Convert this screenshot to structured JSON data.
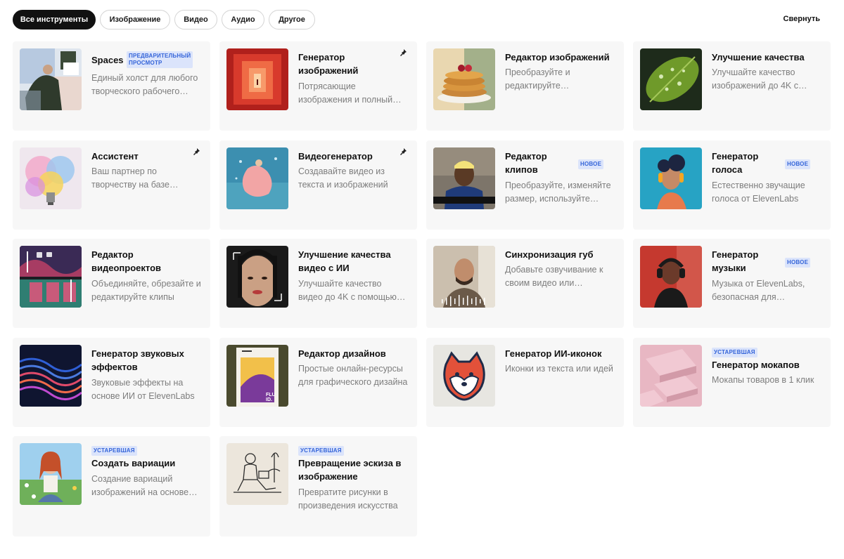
{
  "filters": {
    "all": "Все инструменты",
    "image": "Изображение",
    "video": "Видео",
    "audio": "Аудио",
    "other": "Другое",
    "collapse": "Свернуть"
  },
  "badges": {
    "preview_line1": "Предварительный",
    "preview_line2": "просмотр",
    "new": "Новое",
    "legacy": "Устаревшая"
  },
  "cards": {
    "spaces": {
      "title": "Spaces",
      "desc1": "Единый холст для любого",
      "desc2": "творческого рабочего…"
    },
    "image_gen": {
      "title1": "Генератор",
      "title2": "изображений",
      "desc1": "Потрясающие",
      "desc2": "изображения и полный…"
    },
    "image_editor": {
      "title": "Редактор изображений",
      "desc1": "Преобразуйте и",
      "desc2": "редактируйте…"
    },
    "upscale": {
      "title": "Улучшение качества",
      "desc1": "Улучшайте качество",
      "desc2": "изображений до 4K с…"
    },
    "assistant": {
      "title": "Ассистент",
      "desc1": "Ваш партнер по",
      "desc2": "творчеству на базе…"
    },
    "video_gen": {
      "title": "Видеогенератор",
      "desc1": "Создавайте видео из",
      "desc2": "текста и изображений"
    },
    "clip_editor": {
      "title1": "Редактор",
      "title2": "клипов",
      "desc1": "Преобразуйте, изменяйте",
      "desc2": "размер, используйте…"
    },
    "voice_gen": {
      "title1": "Генератор",
      "title2": "голоса",
      "desc1": "Естественно звучащие",
      "desc2": "голоса от ElevenLabs"
    },
    "video_project_editor": {
      "title1": "Редактор",
      "title2": "видеопроектов",
      "desc1": "Объединяйте, обрезайте и",
      "desc2": "редактируйте клипы"
    },
    "video_upscale": {
      "title1": "Улучшение качества",
      "title2": "видео с ИИ",
      "desc1": "Улучшайте качество",
      "desc2": "видео до 4K с помощью…"
    },
    "lip_sync": {
      "title": "Синхронизация губ",
      "desc1": "Добавьте озвучивание к",
      "desc2": "своим видео или…"
    },
    "music_gen": {
      "title1": "Генератор",
      "title2": "музыки",
      "desc1": "Музыка от ElevenLabs,",
      "desc2": "безопасная для…"
    },
    "sfx_gen": {
      "title1": "Генератор звуковых",
      "title2": "эффектов",
      "desc1": "Звуковые эффекты на",
      "desc2": "основе ИИ от ElevenLabs"
    },
    "design_editor": {
      "title": "Редактор дизайнов",
      "desc1": "Простые онлайн-ресурсы",
      "desc2": "для графического дизайна"
    },
    "icon_gen": {
      "title": "Генератор ИИ-иконок",
      "desc1": "Иконки из текста или идей"
    },
    "mockup_gen": {
      "title": "Генератор мокапов",
      "desc1": "Мокапы товаров в 1 клик"
    },
    "variations": {
      "title": "Создать вариации",
      "desc1": "Создание вариаций",
      "desc2": "изображений на основе…"
    },
    "sketch_to_image": {
      "title1": "Превращение эскиза в",
      "title2": "изображение",
      "desc1": "Превратите рисунки в",
      "desc2": "произведения искусства"
    }
  },
  "thumbnail_texts": {
    "design_poster": "FLU ID."
  },
  "colors": {
    "badge_bg": "#dbe4fb",
    "badge_text": "#3565d9",
    "active_filter": "#111111",
    "card_bg": "#f7f7f7"
  },
  "icons": [
    "pin-icon",
    "mute-icon",
    "camera-icon"
  ]
}
